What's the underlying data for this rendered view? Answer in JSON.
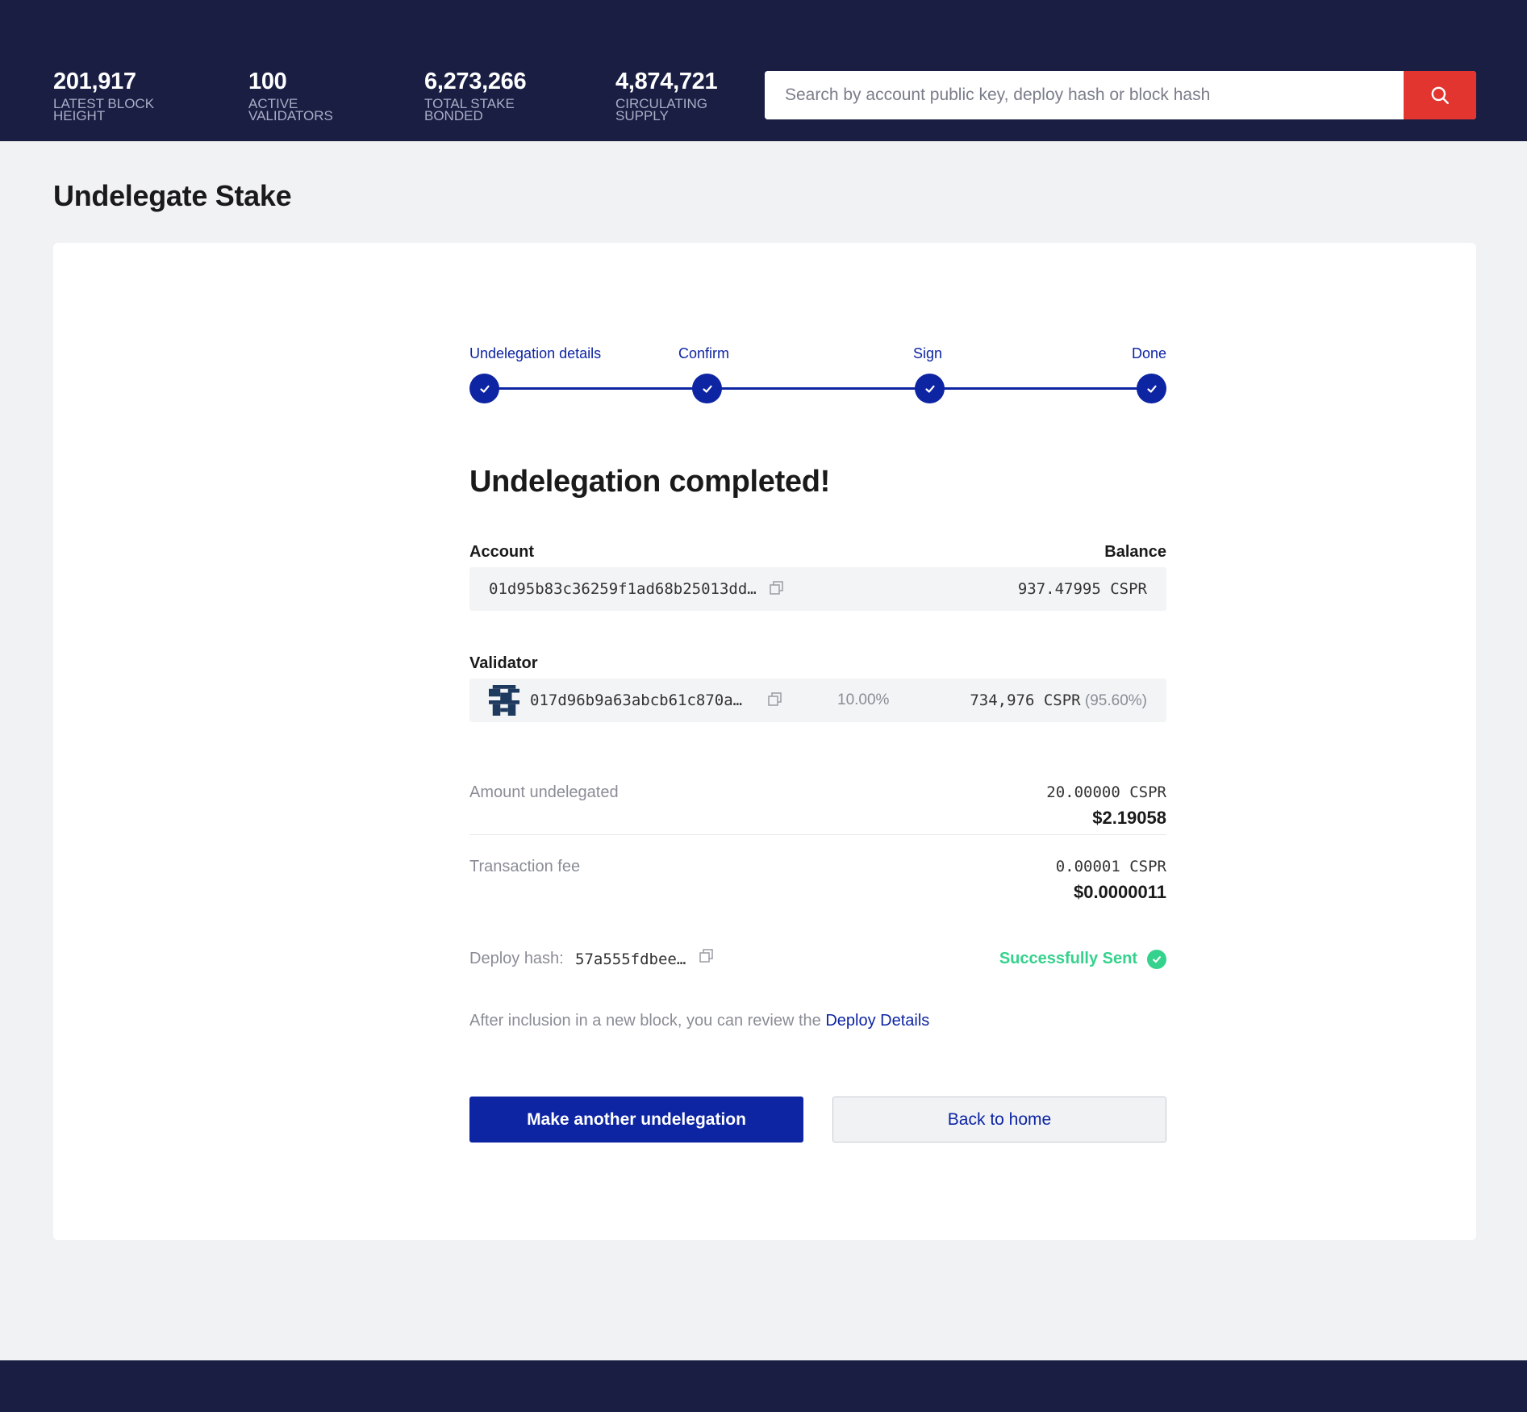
{
  "header": {
    "stats": [
      {
        "value": "201,917",
        "label": "LATEST BLOCK HEIGHT"
      },
      {
        "value": "100",
        "label": "ACTIVE VALIDATORS"
      },
      {
        "value": "6,273,266",
        "label": "TOTAL STAKE BONDED"
      },
      {
        "value": "4,874,721",
        "label": "CIRCULATING SUPPLY"
      }
    ],
    "search": {
      "placeholder": "Search by account public key, deploy hash or block hash",
      "icon": "search-icon"
    }
  },
  "page": {
    "title": "Undelegate Stake"
  },
  "stepper": {
    "steps": [
      "Undelegation details",
      "Confirm",
      "Sign",
      "Done"
    ],
    "completed_steps": 4,
    "color": "#0d24a3"
  },
  "result": {
    "title": "Undelegation completed!",
    "account_label": "Account",
    "balance_label": "Balance",
    "account_hash": "01d95b83c36259f1ad68b25013dd…",
    "balance": "937.47995 CSPR",
    "validator_label": "Validator",
    "validator_hash": "017d96b9a63abcb61c870a…",
    "validator_fee": "10.00%",
    "validator_stake": "734,976 CSPR",
    "validator_stake_share": "(95.60%)",
    "amount_label": "Amount undelegated",
    "amount_cspr": "20.00000 CSPR",
    "amount_usd": "$2.19058",
    "fee_label": "Transaction fee",
    "fee_cspr": "0.00001 CSPR",
    "fee_usd": "$0.0000011",
    "deploy_label": "Deploy hash:",
    "deploy_hash": "57a555fdbee…",
    "status": "Successfully Sent",
    "status_color": "#35d28d",
    "info_text": "After inclusion in a new block, you can review the ",
    "info_link": "Deploy Details"
  },
  "actions": {
    "primary": "Make another undelegation",
    "secondary": "Back to home"
  },
  "colors": {
    "nav_bg": "#1a1e43",
    "accent": "#0d24a3",
    "search_btn": "#e33530"
  }
}
